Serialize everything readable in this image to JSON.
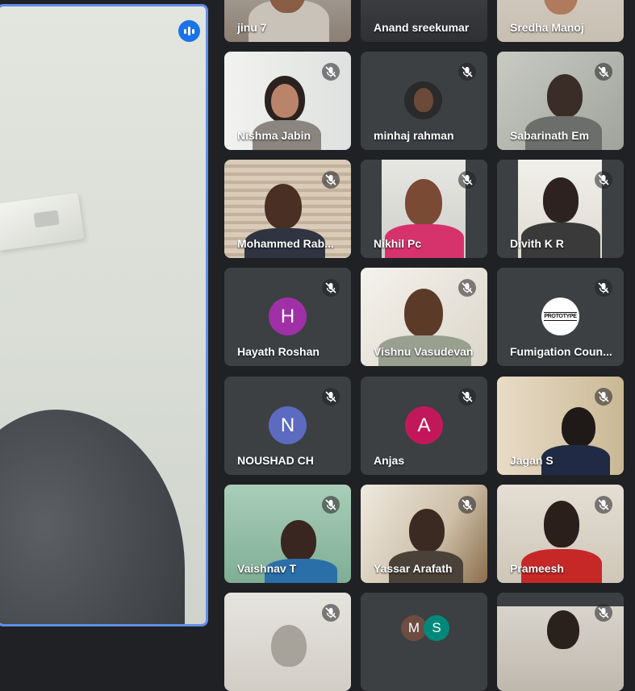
{
  "main": {
    "speaking_indicator": "speaking-icon"
  },
  "participants": [
    {
      "name": "jinu 7",
      "avatar": null,
      "muted": false
    },
    {
      "name": "Anand sreekumar",
      "avatar": null,
      "muted": false
    },
    {
      "name": "Sredha Manoj",
      "avatar": null,
      "muted": false
    },
    {
      "name": "Nishma Jabin",
      "avatar": null,
      "muted": true
    },
    {
      "name": "minhaj rahman",
      "avatar": null,
      "muted": true
    },
    {
      "name": "Sabarinath Em",
      "avatar": null,
      "muted": true
    },
    {
      "name": "Mohammed Rab...",
      "avatar": null,
      "muted": true
    },
    {
      "name": "Nikhil Pc",
      "avatar": null,
      "muted": true
    },
    {
      "name": "Divith K R",
      "avatar": null,
      "muted": true
    },
    {
      "name": "Hayath Roshan",
      "avatar": "H",
      "muted": true
    },
    {
      "name": "Vishnu Vasudevan",
      "avatar": null,
      "muted": true
    },
    {
      "name": "Fumigation Coun...",
      "avatar": null,
      "logo_text": "PROTOTYPE",
      "muted": true
    },
    {
      "name": "NOUSHAD CH",
      "avatar": "N",
      "muted": true
    },
    {
      "name": "Anjas",
      "avatar": "A",
      "muted": true
    },
    {
      "name": "Jagan S",
      "avatar": null,
      "muted": true
    },
    {
      "name": "Vaishnav T",
      "avatar": null,
      "muted": true
    },
    {
      "name": "Yassar Arafath",
      "avatar": null,
      "muted": true
    },
    {
      "name": "Prameesh",
      "avatar": null,
      "muted": true
    }
  ],
  "group_tile": {
    "avatars": [
      "M",
      "S"
    ]
  },
  "colors": {
    "background": "#202124",
    "tile": "#3c4043",
    "active_speaker_border": "#5f8ee8",
    "speaking_badge": "#1a73e8",
    "avatar_h": "#a030a8",
    "avatar_n": "#5c6bc0",
    "avatar_a": "#c2185b",
    "avatar_m": "#6d4c41",
    "avatar_s": "#00897b"
  }
}
